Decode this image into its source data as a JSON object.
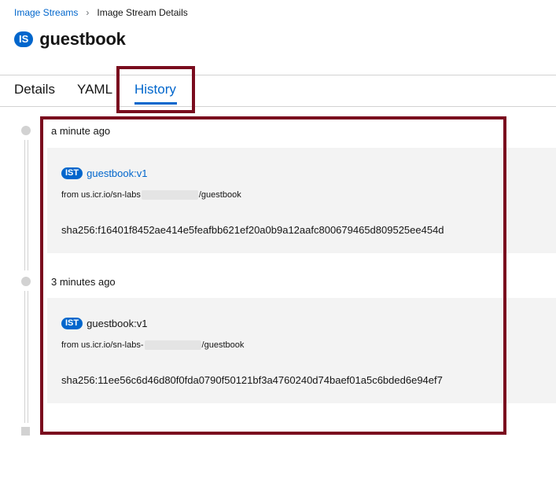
{
  "breadcrumb": {
    "parent": "Image Streams",
    "current": "Image Stream Details"
  },
  "header": {
    "badge": "IS",
    "title": "guestbook"
  },
  "tabs": [
    {
      "label": "Details"
    },
    {
      "label": "YAML"
    },
    {
      "label": "History",
      "active": true
    }
  ],
  "history": [
    {
      "time": "a minute ago",
      "badge": "IST",
      "tag": "guestbook:v1",
      "tag_is_link": true,
      "from_prefix": "from us.icr.io/sn-labs",
      "from_suffix": "/guestbook",
      "sha": "sha256:f16401f8452ae414e5feafbb621ef20a0b9a12aafc800679465d809525ee454d"
    },
    {
      "time": "3 minutes ago",
      "badge": "IST",
      "tag": "guestbook:v1",
      "tag_is_link": false,
      "from_prefix": "from us.icr.io/sn-labs-",
      "from_suffix": "/guestbook",
      "sha": "sha256:11ee56c6d46d80f0fda0790f50121bf3a4760240d74baef01a5c6bded6e94ef7"
    }
  ],
  "colors": {
    "link": "#0066cc",
    "highlight": "#7a0c1e",
    "card_bg": "#f3f3f3"
  }
}
